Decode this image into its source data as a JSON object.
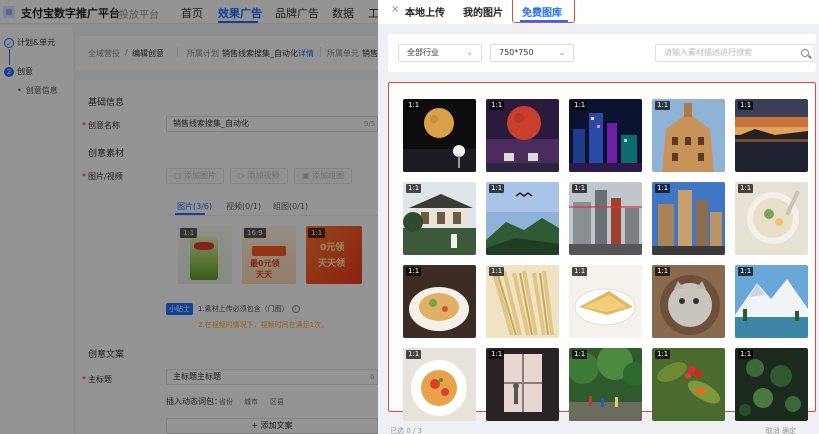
{
  "app": {
    "brand": "支付宝数字推广平台",
    "brand_sub": "投放平台",
    "nav": [
      "首页",
      "效果广告",
      "品牌广告",
      "数据",
      "工"
    ]
  },
  "steps": {
    "s1": "计划&单元",
    "s2": "创意",
    "s2_num": "2",
    "s2_sub": "创意信息"
  },
  "breadcrumb": {
    "root": "全域营投",
    "current": "编辑创意",
    "plan_label": "所属计划",
    "plan_value": "销售线索搜集_自动化",
    "detail": "详情",
    "unit_label": "所属单元",
    "unit_value": "销售"
  },
  "form": {
    "basic_title": "基础信息",
    "name_label": "创意名称",
    "name_value": "销售线索搜集_自动化",
    "name_count": "9/5",
    "material_title": "创意素材",
    "media_label": "图片/视频",
    "btn_add_image": "添加图片",
    "btn_add_video": "添加视频",
    "btn_add_group": "添加组图",
    "tab_image": "图片(3/6)",
    "tab_video": "视频(0/1)",
    "tab_group": "组图(0/1)",
    "thumb1_badge": "1:1",
    "thumb2_badge": "16:9",
    "thumb3_badge": "1:1",
    "ad1_line1": "最0元领",
    "ad1_line2": "天天",
    "ad2_line1": "0元领",
    "ad2_line2": "天天领",
    "tip_tag": "小贴士",
    "tip1": "1.素材上传必须包含（门图）",
    "tip1_icon": "i",
    "tip2": "2.在视频时情况下，视频时间在满足1次。",
    "copy_title": "创意文案",
    "main_title_label": "主标题",
    "main_title_value": "主标题主标题",
    "main_title_count": "6",
    "insert_label": "插入动态词包：",
    "insert_words": [
      "省份",
      "城市",
      "区县"
    ],
    "add_copy": "+ 添加文案"
  },
  "drawer": {
    "close": "×",
    "tabs": [
      "本地上传",
      "我的图片",
      "免费图库"
    ],
    "industry": "全部行业",
    "size": "750*750",
    "search_placeholder": "请输入素材描述进行搜索",
    "badge": "1:1",
    "footer_left": "已选 0 / 3",
    "footer_right": "取消    确定"
  },
  "gallery": [
    {
      "name": "moon-night-lamp"
    },
    {
      "name": "red-moon-chairs"
    },
    {
      "name": "city-night-skyline"
    },
    {
      "name": "european-building-dusk"
    },
    {
      "name": "sunset-lake"
    },
    {
      "name": "classical-garden-pavilion"
    },
    {
      "name": "mountain-bird-sky"
    },
    {
      "name": "city-square-buildings"
    },
    {
      "name": "office-towers-blue-sky"
    },
    {
      "name": "soup-bowl-topdown"
    },
    {
      "name": "pasta-plate"
    },
    {
      "name": "dried-noodles-bundle"
    },
    {
      "name": "crepe-on-plate"
    },
    {
      "name": "cat-in-basket"
    },
    {
      "name": "snowy-mountain-painting"
    },
    {
      "name": "spaghetti-tomato"
    },
    {
      "name": "window-silhouette"
    },
    {
      "name": "park-crowd-trees"
    },
    {
      "name": "red-berries-foliage"
    },
    {
      "name": "green-leaves-dark"
    }
  ],
  "colors": {
    "primary": "#1f6fff",
    "highlight_border": "#f04438",
    "tip_orange": "#f5a623",
    "required": "#f5222d"
  }
}
